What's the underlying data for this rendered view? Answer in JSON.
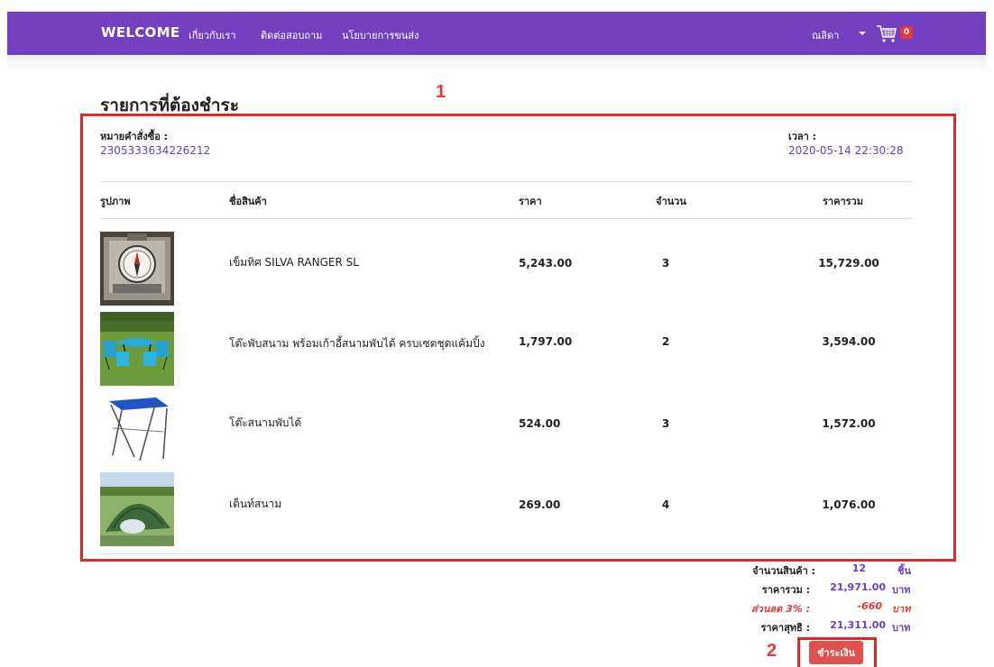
{
  "navbar": {
    "brand": "WELCOME",
    "links": [
      "เกี่ยวกับเรา",
      "ติดต่อสอบถาม",
      "นโยบายการขนส่ง"
    ],
    "user_name": "ณลิดา",
    "cart_count": "0"
  },
  "page_title": "รายการที่ต้องชำระ",
  "annotations": {
    "box1": "1",
    "box2": "2"
  },
  "order": {
    "number_label": "หมายคำสั่งซื้อ :",
    "number_value": "2305333634226212",
    "time_label": "เวลา :",
    "time_value": "2020-05-14 22:30:28"
  },
  "table": {
    "headers": [
      "รูปภาพ",
      "ชื่อสินค้า",
      "ราคา",
      "จำนวน",
      "ราคารวม"
    ],
    "rows": [
      {
        "image": "compass-photo",
        "name": "เข็มทิศ SILVA RANGER SL",
        "price": "5,243.00",
        "qty": "3",
        "total": "15,729.00"
      },
      {
        "image": "camping-table-chairs-photo",
        "name": "โต๊ะพับสนาม พร้อมเก้าอี้สนามพับได้ ครบเซตชุดแค้มปิ้ง",
        "price": "1,797.00",
        "qty": "2",
        "total": "3,594.00"
      },
      {
        "image": "folding-table-photo",
        "name": "โต๊ะสนามพับได้",
        "price": "524.00",
        "qty": "3",
        "total": "1,572.00"
      },
      {
        "image": "tent-photo",
        "name": "เต็นท์สนาม",
        "price": "269.00",
        "qty": "4",
        "total": "1,076.00"
      }
    ]
  },
  "summary": {
    "count_label": "จำนวนสินค้า :",
    "count_value": "12",
    "count_unit": "ชิ้น",
    "subtotal_label": "ราคารวม :",
    "subtotal_value": "21,971.00",
    "subtotal_unit": "บาท",
    "discount_label": "ส่วนลด 3% :",
    "discount_value": "-660",
    "discount_unit": "บาท",
    "net_label": "ราคาสุทธิ :",
    "net_value": "21,311.00",
    "net_unit": "บาท"
  },
  "pay_button": "ชำระเงิน",
  "colors": {
    "navbar": "#7340c1",
    "accent": "#6c3fc0",
    "annotation": "#e3262c",
    "pay_button": "#e0504d"
  }
}
